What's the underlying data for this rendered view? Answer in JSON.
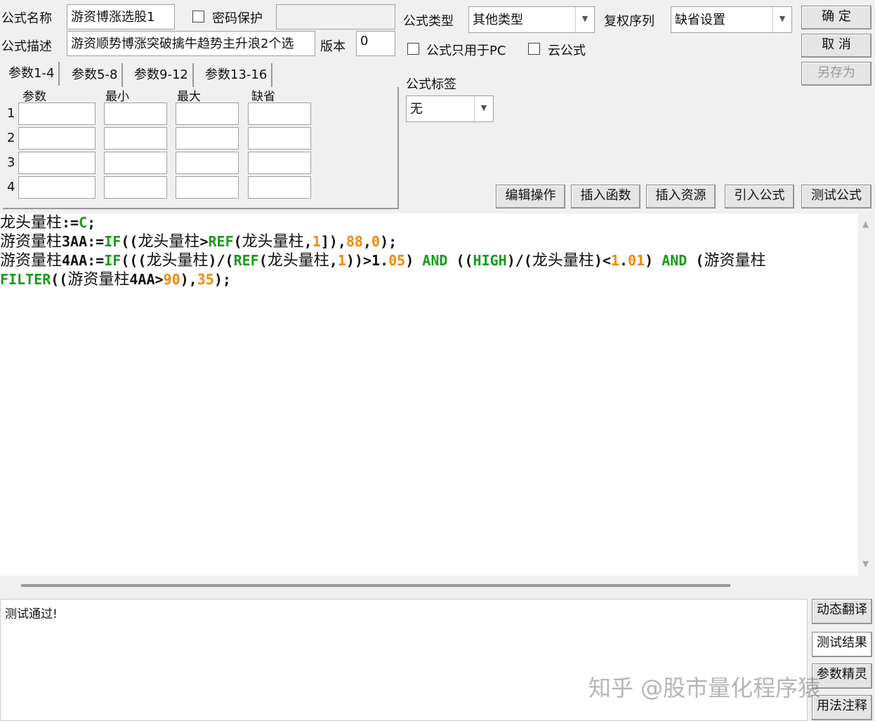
{
  "form": {
    "name_label": "公式名称",
    "name_value": "游资博涨选股1",
    "password_label": "密码保护",
    "desc_label": "公式描述",
    "desc_value": "游资顺势博涨突破擒牛趋势主升浪2个选",
    "version_label": "版本",
    "version_value": "0",
    "type_label": "公式类型",
    "type_value": "其他类型",
    "rights_label": "复权序列",
    "rights_value": "缺省设置",
    "pc_only_label": "公式只用于PC",
    "cloud_label": "云公式",
    "tag_label": "公式标签",
    "tag_value": "无"
  },
  "buttons": {
    "ok": "确 定",
    "cancel": "取 消",
    "save_as": "另存为",
    "edit": "编辑操作",
    "insert_func": "插入函数",
    "insert_res": "插入资源",
    "import": "引入公式",
    "test": "测试公式",
    "dyn_translate": "动态翻译",
    "test_result": "测试结果",
    "param_wizard": "参数精灵",
    "usage": "用法注释"
  },
  "tabs": [
    "参数1-4",
    "参数5-8",
    "参数9-12",
    "参数13-16"
  ],
  "params": {
    "headers": [
      "参数",
      "最小",
      "最大",
      "缺省"
    ],
    "rows": [
      "1",
      "2",
      "3",
      "4"
    ]
  },
  "code": [
    [
      [
        "cn",
        "龙头量柱"
      ],
      [
        "t",
        ":="
      ],
      [
        "kw",
        "C"
      ],
      [
        "t",
        ";"
      ]
    ],
    [
      [
        "cn",
        "游资量柱"
      ],
      [
        "t",
        "3AA:="
      ],
      [
        "kw",
        "IF"
      ],
      [
        "t",
        "(("
      ],
      [
        "cn",
        "龙头量柱"
      ],
      [
        "t",
        ">"
      ],
      [
        "kw",
        "REF"
      ],
      [
        "t",
        "("
      ],
      [
        "cn",
        "龙头量柱"
      ],
      [
        "t",
        ","
      ],
      [
        "num",
        "1"
      ],
      [
        "t",
        "]),"
      ],
      [
        "num",
        "88"
      ],
      [
        "t",
        ","
      ],
      [
        "num",
        "0"
      ],
      [
        "t",
        ");"
      ]
    ],
    [
      [
        "cn",
        "游资量柱"
      ],
      [
        "t",
        "4AA:="
      ],
      [
        "kw",
        "IF"
      ],
      [
        "t",
        "((("
      ],
      [
        "cn",
        "龙头量柱"
      ],
      [
        "t",
        ")/("
      ],
      [
        "kw",
        "REF"
      ],
      [
        "t",
        "("
      ],
      [
        "cn",
        "龙头量柱"
      ],
      [
        "t",
        ","
      ],
      [
        "num",
        "1"
      ],
      [
        "t",
        "))>1."
      ],
      [
        "num",
        "05"
      ],
      [
        "t",
        ") "
      ],
      [
        "kw",
        "AND"
      ],
      [
        "t",
        " (("
      ],
      [
        "kw",
        "HIGH"
      ],
      [
        "t",
        ")/("
      ],
      [
        "cn",
        "龙头量柱"
      ],
      [
        "t",
        ")<"
      ],
      [
        "num",
        "1"
      ],
      [
        "t",
        "."
      ],
      [
        "num",
        "01"
      ],
      [
        "t",
        ") "
      ],
      [
        "kw",
        "AND"
      ],
      [
        "t",
        " ("
      ],
      [
        "cn",
        "游资量柱"
      ]
    ],
    [
      [
        "kw",
        "FILTER"
      ],
      [
        "t",
        "(("
      ],
      [
        "cn",
        "游资量柱"
      ],
      [
        "t",
        "4AA>"
      ],
      [
        "num",
        "90"
      ],
      [
        "t",
        "),"
      ],
      [
        "num",
        "35"
      ],
      [
        "t",
        ");"
      ]
    ]
  ],
  "output": {
    "text": "测试通过!"
  },
  "watermark": "知乎 @股市量化程序猿"
}
